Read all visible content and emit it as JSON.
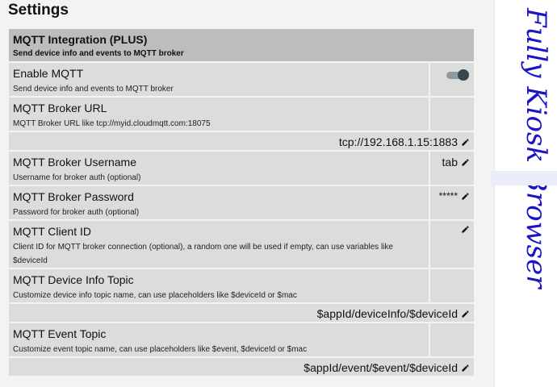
{
  "page": {
    "title": "Settings"
  },
  "section": {
    "title": "MQTT Integration (PLUS)",
    "subtitle": "Send device info and events to MQTT broker"
  },
  "settings": [
    {
      "title": "Enable MQTT",
      "desc": "Send device info and events to MQTT broker",
      "type": "toggle",
      "enabled": true
    },
    {
      "title": "MQTT Broker URL",
      "desc": "MQTT Broker URL like tcp://myid.cloudmqtt.com:18075",
      "value": "tcp://192.168.1.15:1883"
    },
    {
      "title": "MQTT Broker Username",
      "desc": "Username for broker auth (optional)",
      "value": "tab"
    },
    {
      "title": "MQTT Broker Password",
      "desc": "Password for broker auth (optional)",
      "value": "*****"
    },
    {
      "title": "MQTT Client ID",
      "desc": "Client ID for MQTT broker connection (optional), a random one will be used if empty, can use variables like $deviceId",
      "value": ""
    },
    {
      "title": "MQTT Device Info Topic",
      "desc": "Customize device info topic name, can use placeholders like $deviceId or $mac",
      "value": "$appId/deviceInfo/$deviceId"
    },
    {
      "title": "MQTT Event Topic",
      "desc": "Customize event topic name, can use placeholders like $event, $deviceId or $mac",
      "value": "$appId/event/$event/$deviceId"
    }
  ],
  "brand": {
    "text": "Fully Kiosk Browser",
    "color": "#1a14c8"
  },
  "colors": {
    "toggle_knob": "#37474f",
    "toggle_track": "#8d9aa0"
  },
  "icons": {
    "edit": "pencil-icon"
  }
}
